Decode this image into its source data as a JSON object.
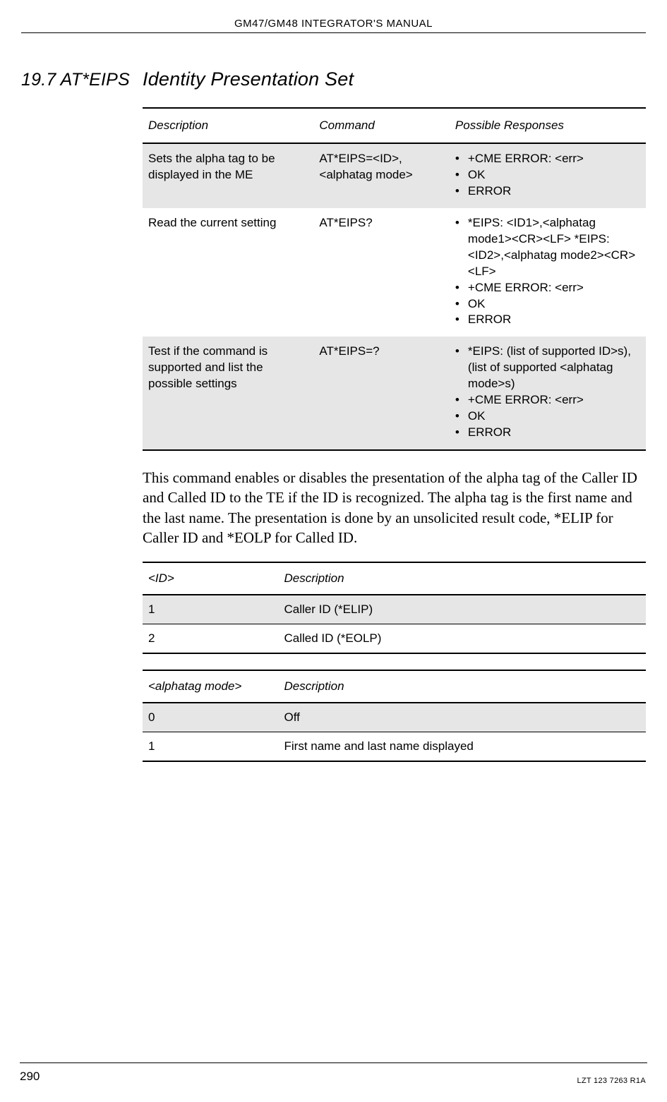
{
  "header": {
    "title": "GM47/GM48 INTEGRATOR'S MANUAL"
  },
  "section": {
    "number": "19.7 AT*EIPS",
    "title": "Identity Presentation Set"
  },
  "cmd_table": {
    "headers": {
      "description": "Description",
      "command": "Command",
      "responses": "Possible Responses"
    },
    "rows": [
      {
        "description": "Sets the alpha tag to be displayed in the ME",
        "command": "AT*EIPS=<ID>, <alphatag mode>",
        "responses": [
          "+CME ERROR: <err>",
          "OK",
          "ERROR"
        ]
      },
      {
        "description": "Read the current setting",
        "command": "AT*EIPS?",
        "responses": [
          "*EIPS: <ID1>,<alphatag mode1><CR><LF> *EIPS:<ID2>,<alphatag mode2><CR><LF>",
          "+CME ERROR: <err>",
          "OK",
          "ERROR"
        ]
      },
      {
        "description": "Test if the command is supported and list the possible settings",
        "command": "AT*EIPS=?",
        "responses": [
          "*EIPS: (list of supported ID>s),(list of supported <alphatag mode>s)",
          "+CME ERROR: <err>",
          "OK",
          "ERROR"
        ]
      }
    ]
  },
  "body_paragraph": "This command enables or disables the presentation of the alpha tag of the Caller ID and Called ID to the TE if the ID is recognized. The alpha tag is the first name and the last name. The presentation is done by an unsolicited result code, *ELIP for Caller ID and *EOLP for Called ID.",
  "id_table": {
    "headers": {
      "id": "<ID>",
      "desc": "Description"
    },
    "rows": [
      {
        "id": "1",
        "desc": "Caller ID (*ELIP)"
      },
      {
        "id": "2",
        "desc": "Called ID (*EOLP)"
      }
    ]
  },
  "mode_table": {
    "headers": {
      "mode": "<alphatag mode>",
      "desc": "Description"
    },
    "rows": [
      {
        "mode": "0",
        "desc": "Off"
      },
      {
        "mode": "1",
        "desc": "First name and last name displayed"
      }
    ]
  },
  "footer": {
    "page": "290",
    "docid": "LZT 123 7263 R1A"
  }
}
